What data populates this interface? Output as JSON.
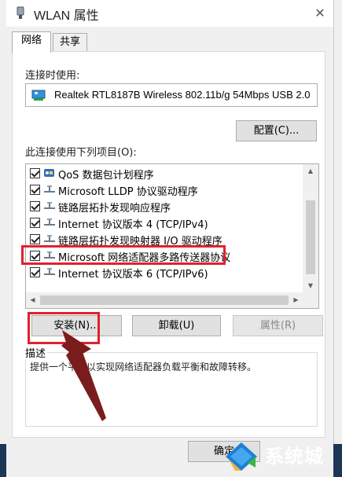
{
  "window": {
    "title": "WLAN 属性"
  },
  "tabs": [
    {
      "label": "网络"
    },
    {
      "label": "共享"
    }
  ],
  "connect_using": {
    "label": "连接时使用:",
    "adapter": "Realtek RTL8187B Wireless 802.11b/g 54Mbps USB 2.0"
  },
  "buttons": {
    "configure": "配置(C)...",
    "install": "安装(N)...",
    "uninstall": "卸载(U)",
    "properties": "属性(R)",
    "ok": "确定"
  },
  "items_label": "此连接使用下列项目(O):",
  "items": [
    {
      "label": "QoS 数据包计划程序",
      "checked": true,
      "icon": "qos-icon"
    },
    {
      "label": "Microsoft LLDP 协议驱动程序",
      "checked": true,
      "icon": "protocol-icon"
    },
    {
      "label": "链路层拓扑发现响应程序",
      "checked": true,
      "icon": "protocol-icon"
    },
    {
      "label": "Internet 协议版本 4 (TCP/IPv4)",
      "checked": true,
      "icon": "protocol-icon"
    },
    {
      "label": "链路层拓扑发现映射器 I/O 驱动程序",
      "checked": true,
      "icon": "protocol-icon"
    },
    {
      "label": "Microsoft 网络适配器多路传送器协议",
      "checked": true,
      "icon": "protocol-icon"
    },
    {
      "label": "Internet 协议版本 6 (TCP/IPv6)",
      "checked": true,
      "icon": "protocol-icon"
    }
  ],
  "description": {
    "title": "描述",
    "text": "提供一个平台以实现网络适配器负载平衡和故障转移。"
  },
  "watermark": {
    "name": "系统城",
    "url": "xitongcheng.com"
  },
  "colors": {
    "highlight": "#e0212e",
    "arrow": "#7a1c1c",
    "taskbar": "#1d3557"
  }
}
